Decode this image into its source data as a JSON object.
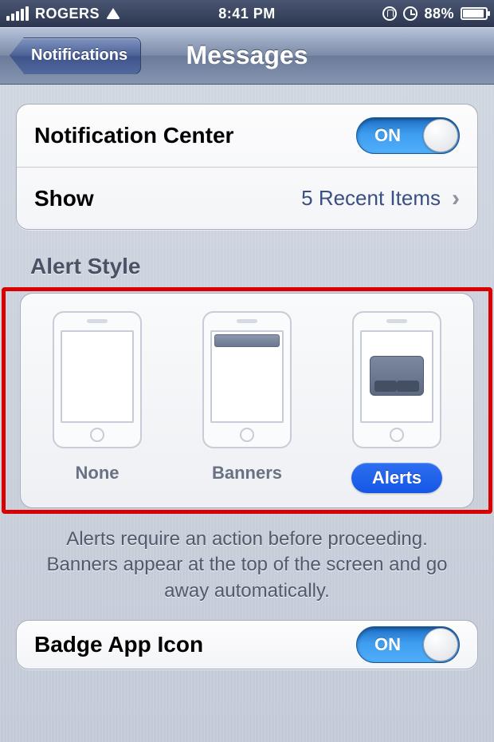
{
  "statusBar": {
    "carrier": "ROGERS",
    "time": "8:41 PM",
    "batteryPercent": "88%"
  },
  "nav": {
    "backLabel": "Notifications",
    "title": "Messages"
  },
  "group1": {
    "notificationCenterLabel": "Notification Center",
    "toggleOn": "ON",
    "showLabel": "Show",
    "showValue": "5 Recent Items"
  },
  "alertStyle": {
    "header": "Alert Style",
    "options": {
      "none": "None",
      "banners": "Banners",
      "alerts": "Alerts"
    },
    "description": "Alerts require an action before proceeding. Banners appear at the top of the screen and go away automatically."
  },
  "group2": {
    "badgeLabel": "Badge App Icon",
    "toggleOn": "ON"
  }
}
